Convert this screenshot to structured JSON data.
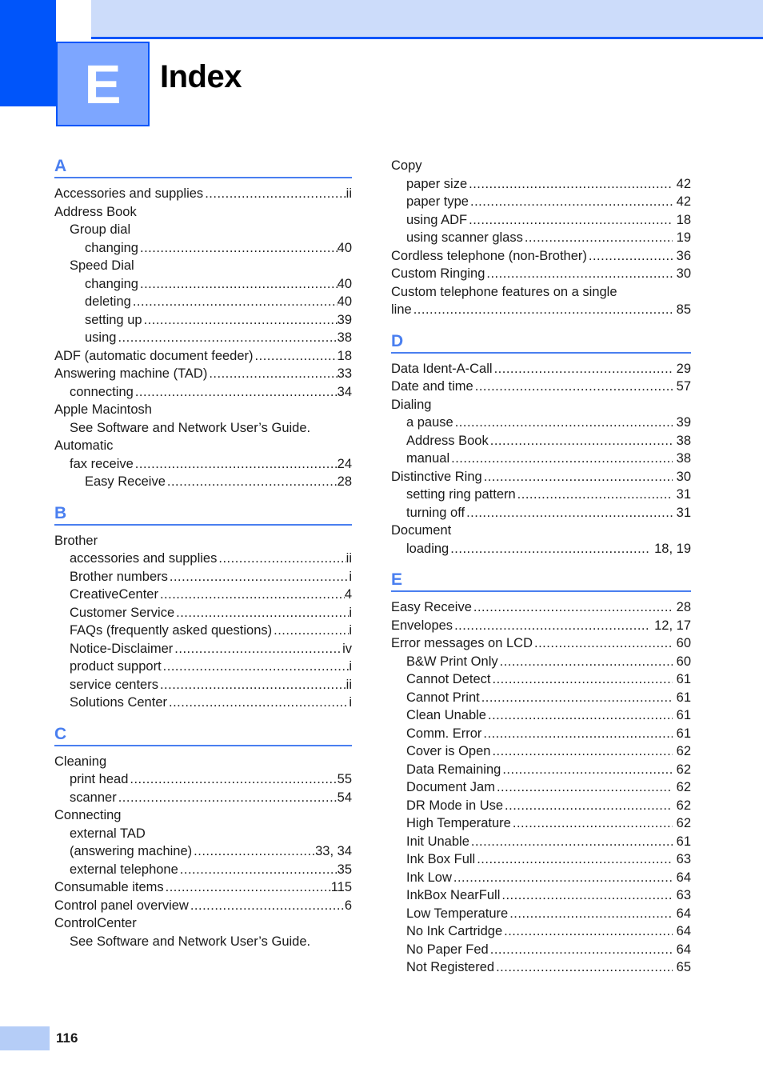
{
  "header": {
    "chapter_letter": "E",
    "title": "Index",
    "accent_dark_blue": "#0055fa",
    "accent_pale_blue": "#ccdcfa",
    "accent_mid_blue": "#7da6ff"
  },
  "footer": {
    "page_number": "116",
    "bar_color": "#b5cdf7"
  },
  "leader_dots": "...................................................................................................................",
  "columns": [
    {
      "name": "left",
      "sections": [
        {
          "letter": "A",
          "entries": [
            {
              "text": "Accessories and supplies",
              "page": "ii",
              "level": 0,
              "leader": true
            },
            {
              "text": "Address Book",
              "page": "",
              "level": 0,
              "leader": false
            },
            {
              "text": "Group dial",
              "page": "",
              "level": 1,
              "leader": false
            },
            {
              "text": "changing",
              "page": "40",
              "level": 2,
              "leader": true
            },
            {
              "text": "Speed Dial",
              "page": "",
              "level": 1,
              "leader": false
            },
            {
              "text": "changing",
              "page": "40",
              "level": 2,
              "leader": true
            },
            {
              "text": "deleting",
              "page": "40",
              "level": 2,
              "leader": true
            },
            {
              "text": "setting up",
              "page": "39",
              "level": 2,
              "leader": true
            },
            {
              "text": "using",
              "page": "38",
              "level": 2,
              "leader": true
            },
            {
              "text": "ADF (automatic document feeder)",
              "page": "18",
              "level": 0,
              "leader": true
            },
            {
              "text": "Answering machine (TAD)",
              "page": "33",
              "level": 0,
              "leader": true
            },
            {
              "text": "connecting",
              "page": "34",
              "level": 1,
              "leader": true
            },
            {
              "text": "Apple Macintosh",
              "page": "",
              "level": 0,
              "leader": false
            },
            {
              "text": "See Software and Network User’s Guide.",
              "page": "",
              "level": 1,
              "leader": false
            },
            {
              "text": "Automatic",
              "page": "",
              "level": 0,
              "leader": false
            },
            {
              "text": "fax receive",
              "page": "24",
              "level": 1,
              "leader": true
            },
            {
              "text": "Easy Receive",
              "page": "28",
              "level": 2,
              "leader": true
            }
          ]
        },
        {
          "letter": "B",
          "entries": [
            {
              "text": "Brother",
              "page": "",
              "level": 0,
              "leader": false
            },
            {
              "text": "accessories and supplies",
              "page": "ii",
              "level": 1,
              "leader": true
            },
            {
              "text": "Brother numbers",
              "page": "i",
              "level": 1,
              "leader": true
            },
            {
              "text": "CreativeCenter",
              "page": "4",
              "level": 1,
              "leader": true
            },
            {
              "text": "Customer Service",
              "page": "i",
              "level": 1,
              "leader": true
            },
            {
              "text": "FAQs (frequently asked questions)",
              "page": "i",
              "level": 1,
              "leader": true
            },
            {
              "text": "Notice-Disclaimer",
              "page": "iv",
              "level": 1,
              "leader": true
            },
            {
              "text": "product support",
              "page": "i",
              "level": 1,
              "leader": true
            },
            {
              "text": "service centers",
              "page": "ii",
              "level": 1,
              "leader": true
            },
            {
              "text": "Solutions Center",
              "page": "i",
              "level": 1,
              "leader": true
            }
          ]
        },
        {
          "letter": "C",
          "entries": [
            {
              "text": "Cleaning",
              "page": "",
              "level": 0,
              "leader": false
            },
            {
              "text": "print head",
              "page": "55",
              "level": 1,
              "leader": true
            },
            {
              "text": "scanner",
              "page": "54",
              "level": 1,
              "leader": true
            },
            {
              "text": "Connecting",
              "page": "",
              "level": 0,
              "leader": false
            },
            {
              "text": "external TAD",
              "page": "",
              "level": 1,
              "leader": false
            },
            {
              "text": "(answering machine)",
              "page": "33, 34",
              "level": 1,
              "leader": true
            },
            {
              "text": "external telephone",
              "page": "35",
              "level": 1,
              "leader": true
            },
            {
              "text": "Consumable items",
              "page": "115",
              "level": 0,
              "leader": true
            },
            {
              "text": "Control panel overview",
              "page": "6",
              "level": 0,
              "leader": true
            },
            {
              "text": "ControlCenter",
              "page": "",
              "level": 0,
              "leader": false
            },
            {
              "text": "See Software and Network User’s Guide.",
              "page": "",
              "level": 1,
              "leader": false
            }
          ]
        }
      ]
    },
    {
      "name": "right",
      "sections": [
        {
          "letter": "",
          "entries": [
            {
              "text": "Copy",
              "page": "",
              "level": 0,
              "leader": false
            },
            {
              "text": "paper size",
              "page": "42",
              "level": 1,
              "leader": true
            },
            {
              "text": "paper type",
              "page": "42",
              "level": 1,
              "leader": true
            },
            {
              "text": "using ADF",
              "page": "18",
              "level": 1,
              "leader": true
            },
            {
              "text": "using scanner glass",
              "page": "19",
              "level": 1,
              "leader": true
            },
            {
              "text": "Cordless telephone (non-Brother)",
              "page": "36",
              "level": 0,
              "leader": true
            },
            {
              "text": "Custom Ringing",
              "page": "30",
              "level": 0,
              "leader": true
            },
            {
              "text": "Custom telephone features on a single",
              "page": "",
              "level": 0,
              "leader": false
            },
            {
              "text": "line",
              "page": "85",
              "level": 0,
              "leader": true
            }
          ]
        },
        {
          "letter": "D",
          "entries": [
            {
              "text": "Data Ident-A-Call",
              "page": "29",
              "level": 0,
              "leader": true
            },
            {
              "text": "Date and time",
              "page": "57",
              "level": 0,
              "leader": true
            },
            {
              "text": "Dialing",
              "page": "",
              "level": 0,
              "leader": false
            },
            {
              "text": "a pause",
              "page": "39",
              "level": 1,
              "leader": true
            },
            {
              "text": "Address Book",
              "page": "38",
              "level": 1,
              "leader": true
            },
            {
              "text": "manual",
              "page": "38",
              "level": 1,
              "leader": true
            },
            {
              "text": "Distinctive Ring",
              "page": "30",
              "level": 0,
              "leader": true
            },
            {
              "text": "setting ring pattern",
              "page": "31",
              "level": 1,
              "leader": true
            },
            {
              "text": "turning off",
              "page": "31",
              "level": 1,
              "leader": true
            },
            {
              "text": "Document",
              "page": "",
              "level": 0,
              "leader": false
            },
            {
              "text": "loading",
              "page": "18, 19",
              "level": 1,
              "leader": true
            }
          ]
        },
        {
          "letter": "E",
          "entries": [
            {
              "text": "Easy Receive",
              "page": "28",
              "level": 0,
              "leader": true
            },
            {
              "text": "Envelopes",
              "page": "12, 17",
              "level": 0,
              "leader": true
            },
            {
              "text": "Error messages on LCD",
              "page": "60",
              "level": 0,
              "leader": true
            },
            {
              "text": "B&W Print Only",
              "page": "60",
              "level": 1,
              "leader": true
            },
            {
              "text": "Cannot Detect",
              "page": "61",
              "level": 1,
              "leader": true
            },
            {
              "text": "Cannot Print",
              "page": "61",
              "level": 1,
              "leader": true
            },
            {
              "text": "Clean Unable",
              "page": "61",
              "level": 1,
              "leader": true
            },
            {
              "text": "Comm. Error",
              "page": "61",
              "level": 1,
              "leader": true
            },
            {
              "text": "Cover is Open",
              "page": "62",
              "level": 1,
              "leader": true
            },
            {
              "text": "Data Remaining",
              "page": "62",
              "level": 1,
              "leader": true
            },
            {
              "text": "Document Jam",
              "page": "62",
              "level": 1,
              "leader": true
            },
            {
              "text": "DR Mode in Use",
              "page": "62",
              "level": 1,
              "leader": true
            },
            {
              "text": "High Temperature",
              "page": "62",
              "level": 1,
              "leader": true
            },
            {
              "text": "Init Unable",
              "page": "61",
              "level": 1,
              "leader": true
            },
            {
              "text": "Ink Box Full",
              "page": "63",
              "level": 1,
              "leader": true
            },
            {
              "text": "Ink Low",
              "page": "64",
              "level": 1,
              "leader": true
            },
            {
              "text": "InkBox NearFull",
              "page": "63",
              "level": 1,
              "leader": true
            },
            {
              "text": "Low Temperature",
              "page": "64",
              "level": 1,
              "leader": true
            },
            {
              "text": "No Ink Cartridge",
              "page": "64",
              "level": 1,
              "leader": true
            },
            {
              "text": "No Paper Fed",
              "page": "64",
              "level": 1,
              "leader": true
            },
            {
              "text": "Not Registered",
              "page": "65",
              "level": 1,
              "leader": true
            }
          ]
        }
      ]
    }
  ]
}
